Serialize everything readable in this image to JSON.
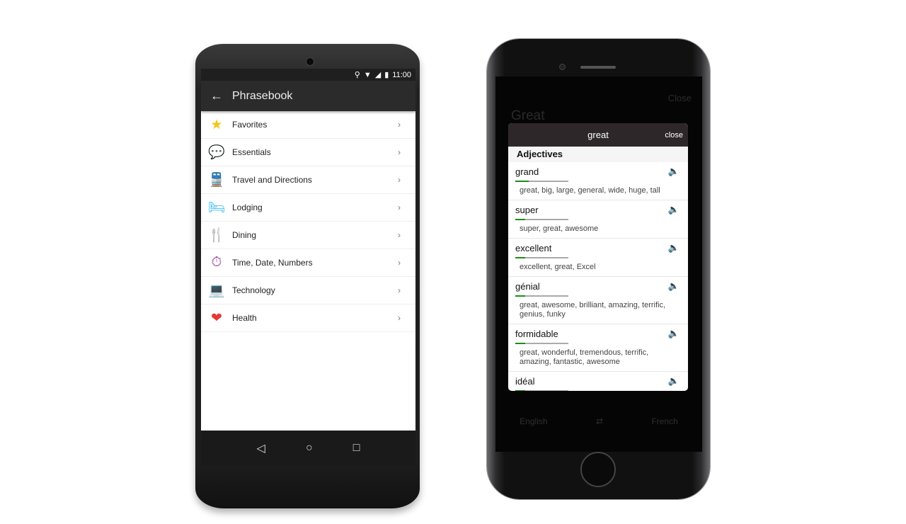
{
  "android": {
    "status": {
      "time": "11:00"
    },
    "toolbar": {
      "title": "Phrasebook"
    },
    "items": [
      {
        "label": "Favorites",
        "icon": "star-icon",
        "glyph": "★",
        "color": "#f5c518"
      },
      {
        "label": "Essentials",
        "icon": "chat-bubbles-icon",
        "glyph": "💬",
        "color": "#4caf50"
      },
      {
        "label": "Travel and Directions",
        "icon": "train-icon",
        "glyph": "🚆",
        "color": "#f4511e"
      },
      {
        "label": "Lodging",
        "icon": "bed-icon",
        "glyph": "🛏",
        "color": "#29b6f6"
      },
      {
        "label": "Dining",
        "icon": "fork-knife-icon",
        "glyph": "🍴",
        "color": "#333333"
      },
      {
        "label": "Time, Date, Numbers",
        "icon": "stopwatch-icon",
        "glyph": "⏱",
        "color": "#9c4f9f"
      },
      {
        "label": "Technology",
        "icon": "laptop-icon",
        "glyph": "💻",
        "color": "#1e88e5"
      },
      {
        "label": "Health",
        "icon": "heart-icon",
        "glyph": "❤",
        "color": "#e53935"
      }
    ],
    "chevron": "›",
    "nav": {
      "back": "◁",
      "home": "○",
      "recents": "□"
    }
  },
  "iphone": {
    "background": {
      "close": "Close",
      "title": "Great",
      "from_lang": "English",
      "swap": "⇄",
      "to_lang": "French"
    },
    "dialog": {
      "title": "great",
      "close": "close",
      "section": "Adjectives",
      "entries": [
        {
          "word": "grand",
          "frequency": 0.25,
          "synonyms": "great, big, large, general, wide, huge, tall"
        },
        {
          "word": "super",
          "frequency": 0.18,
          "synonyms": "super, great, awesome"
        },
        {
          "word": "excellent",
          "frequency": 0.18,
          "synonyms": "excellent, great, Excel"
        },
        {
          "word": "génial",
          "frequency": 0.18,
          "synonyms": "great, awesome, brilliant, amazing, terrific, genius, funky"
        },
        {
          "word": "formidable",
          "frequency": 0.18,
          "synonyms": "great, wonderful, tremendous, terrific, amazing, fantastic, awesome"
        },
        {
          "word": "idéal",
          "frequency": 0.18,
          "synonyms": ""
        }
      ]
    }
  }
}
